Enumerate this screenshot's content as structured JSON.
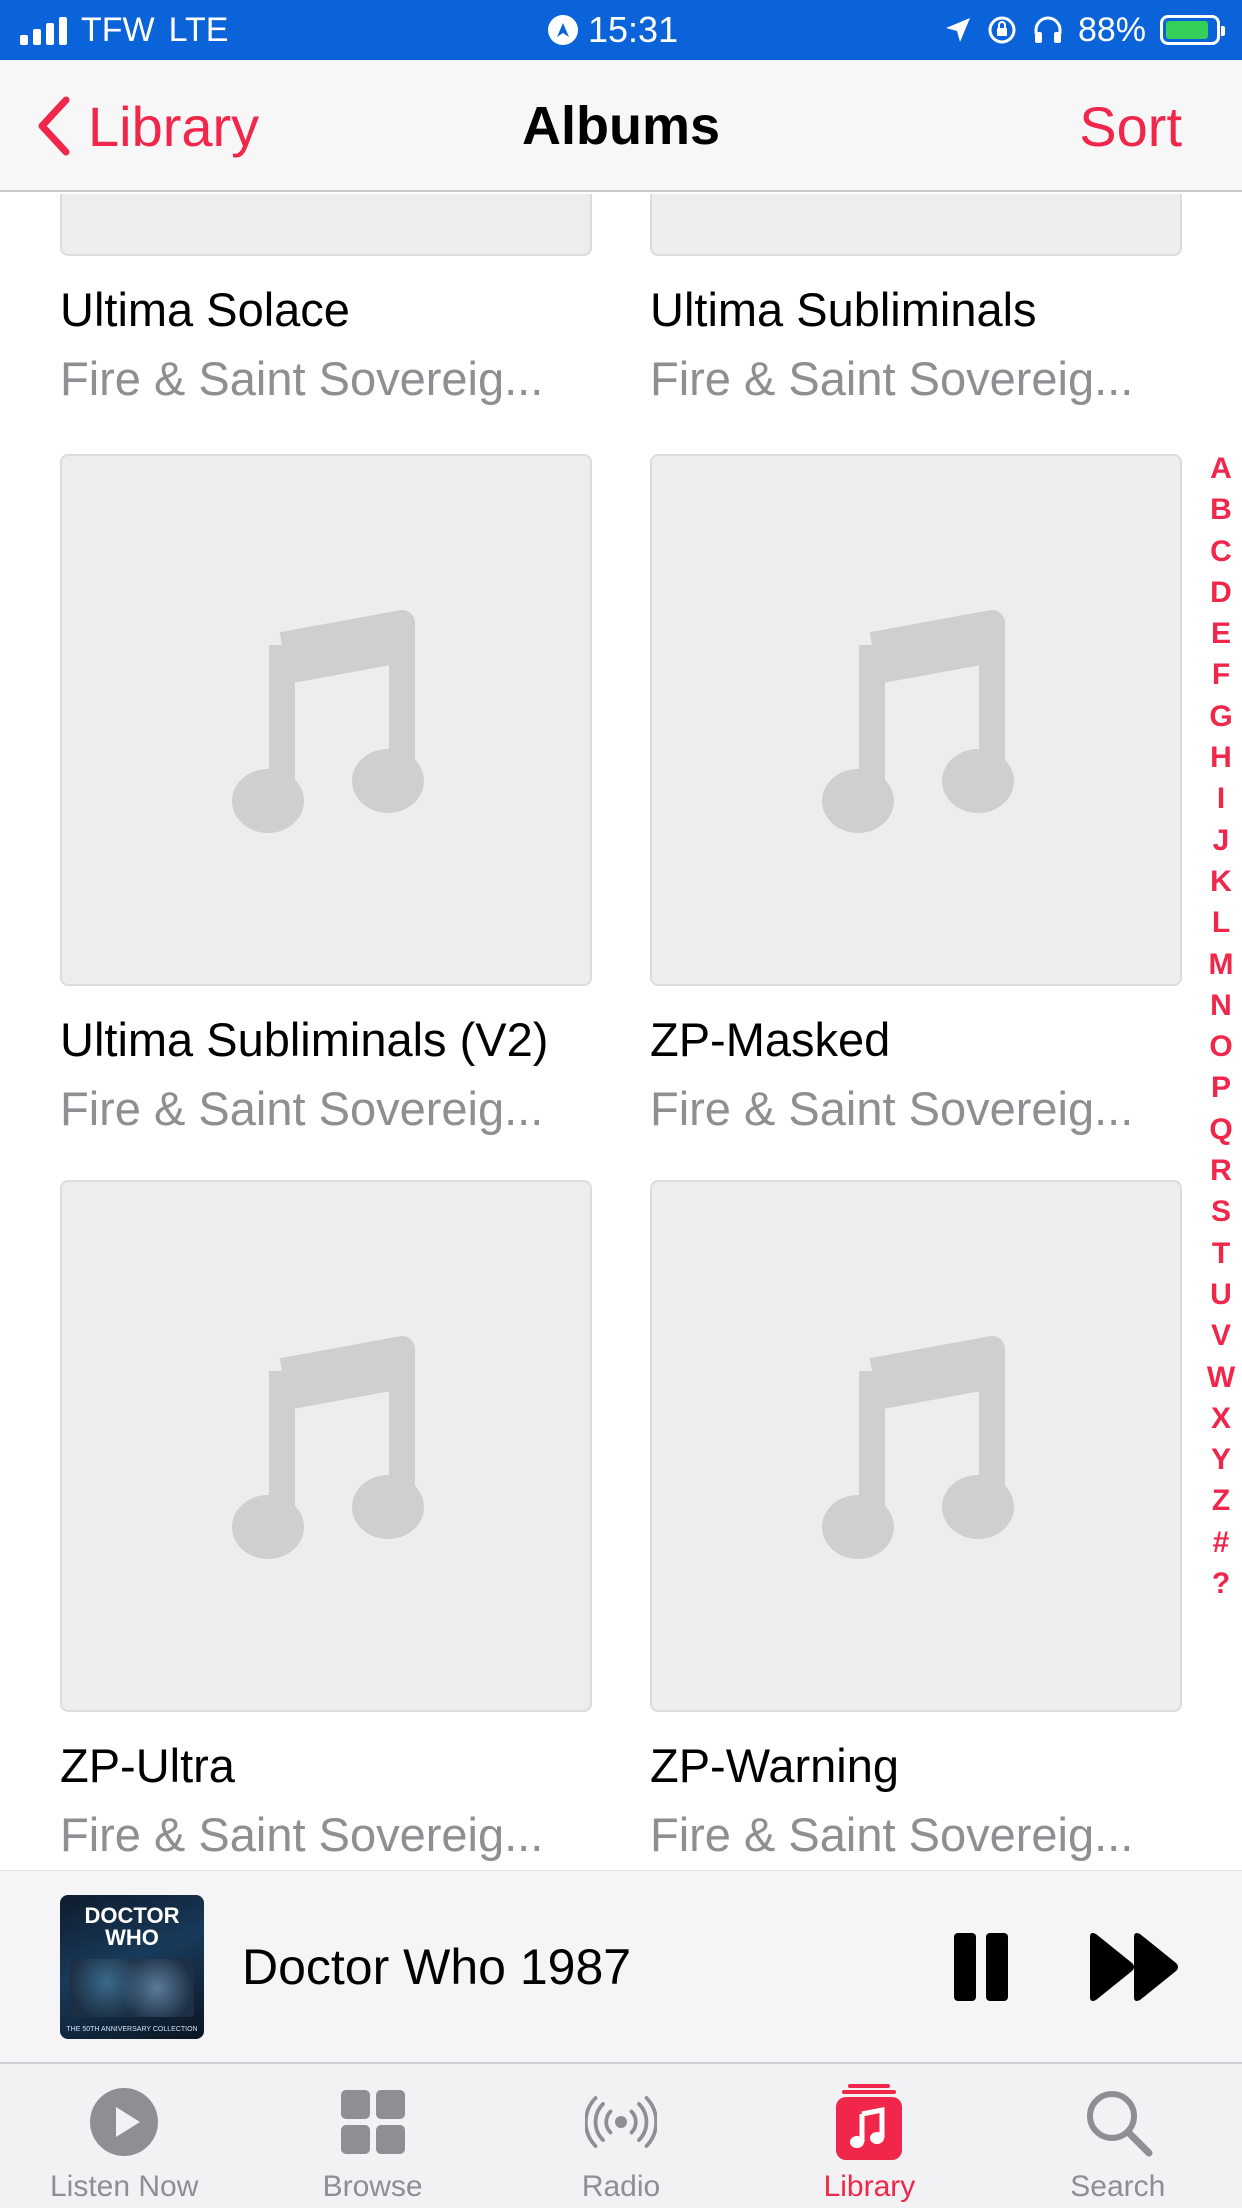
{
  "status_bar": {
    "carrier": "TFW",
    "network": "LTE",
    "time": "15:31",
    "battery": "88%"
  },
  "nav": {
    "back_label": "Library",
    "title": "Albums",
    "sort_label": "Sort"
  },
  "albums": [
    {
      "title": "Ultima Solace",
      "artist": "Fire & Saint Sovereig..."
    },
    {
      "title": "Ultima Subliminals",
      "artist": "Fire & Saint Sovereig..."
    },
    {
      "title": "Ultima Subliminals (V2)",
      "artist": "Fire & Saint Sovereig..."
    },
    {
      "title": "ZP-Masked",
      "artist": "Fire & Saint Sovereig..."
    },
    {
      "title": "ZP-Ultra",
      "artist": "Fire & Saint Sovereig..."
    },
    {
      "title": "ZP-Warning",
      "artist": "Fire & Saint Sovereig..."
    }
  ],
  "index_letters": [
    "A",
    "B",
    "C",
    "D",
    "E",
    "F",
    "G",
    "H",
    "I",
    "J",
    "K",
    "L",
    "M",
    "N",
    "O",
    "P",
    "Q",
    "R",
    "S",
    "T",
    "U",
    "V",
    "W",
    "X",
    "Y",
    "Z",
    "#",
    "?"
  ],
  "mini_player": {
    "title": "Doctor Who 1987",
    "art_logo_top": "DOCTOR",
    "art_logo_bottom": "WHO",
    "art_caption": "THE 50TH ANNIVERSARY COLLECTION"
  },
  "tabs": [
    {
      "label": "Listen Now",
      "icon": "play-circle-icon"
    },
    {
      "label": "Browse",
      "icon": "grid-icon"
    },
    {
      "label": "Radio",
      "icon": "radio-waves-icon"
    },
    {
      "label": "Library",
      "icon": "library-music-icon"
    },
    {
      "label": "Search",
      "icon": "search-icon"
    }
  ],
  "colors": {
    "accent": "#f0264a",
    "status_bar": "#0a63d8",
    "secondary_text": "#8e8e93",
    "placeholder_art": "#ededef"
  }
}
